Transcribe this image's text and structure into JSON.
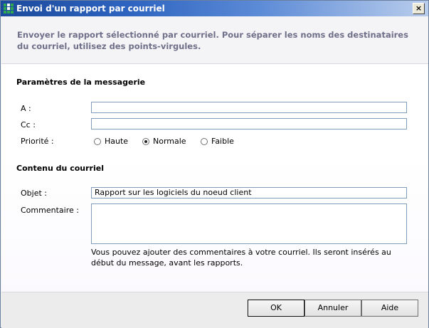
{
  "window": {
    "title": "Envoi d'un rapport par courriel",
    "close_glyph": "×"
  },
  "header": {
    "text": "Envoyer le rapport sélectionné par courriel. Pour séparer les noms des destinataires du courriel, utilisez des points-virgules."
  },
  "messaging": {
    "title": "Paramètres de la messagerie",
    "to_label": "A :",
    "to_value": "",
    "cc_label": "Cc :",
    "cc_value": "",
    "priority_label": "Priorité :",
    "priority_options": [
      {
        "label": "Haute",
        "checked": false
      },
      {
        "label": "Normale",
        "checked": true
      },
      {
        "label": "Faible",
        "checked": false
      }
    ]
  },
  "content": {
    "title": "Contenu du courriel",
    "subject_label": "Objet :",
    "subject_value": "Rapport sur les logiciels du noeud client",
    "comment_label": "Commentaire :",
    "comment_value": "",
    "hint": "Vous pouvez ajouter des commentaires à votre courriel. Ils seront insérés au début du message, avant les rapports."
  },
  "buttons": {
    "ok": "OK",
    "cancel": "Annuler",
    "help": "Aide"
  }
}
